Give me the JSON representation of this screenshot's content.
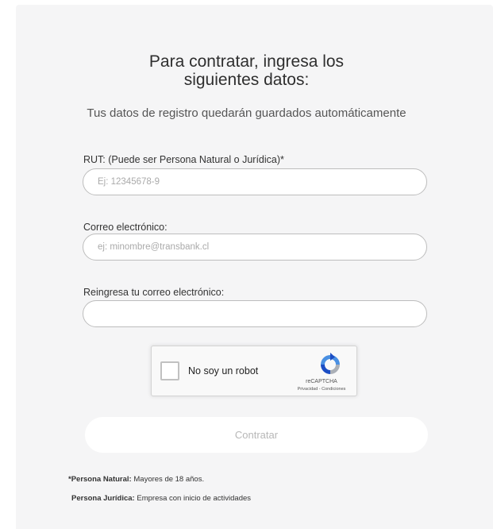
{
  "form": {
    "title_line1": "Para contratar, ingresa los",
    "title_line2": "siguientes datos:",
    "subtitle": "Tus datos de registro quedarán guardados automáticamente",
    "fields": [
      {
        "label": "RUT: (Puede ser Persona Natural o Jurídica)*",
        "value": "",
        "placeholder": "Ej: 12345678-9"
      },
      {
        "label": "Correo electrónico:",
        "value": "",
        "placeholder": "ej: minombre@transbank.cl"
      },
      {
        "label": "Reingresa tu correo electrónico:",
        "value": "",
        "placeholder": ""
      }
    ],
    "submit_label": "Contratar"
  },
  "recaptcha": {
    "label": "No soy un robot",
    "brand": "reCAPTCHA",
    "links": "Privacidad - Condiciones",
    "checked": false,
    "icon": "recaptcha-logo-icon"
  },
  "notes": {
    "natural_term": "*Persona Natural:",
    "natural_text": " Mayores de 18 años.",
    "juridica_term": "Persona Jurídica:",
    "juridica_text": " Empresa con inicio de actividades"
  },
  "colors": {
    "card_background": "#f5f5f6",
    "input_border": "#bdbdbd",
    "disabled_button_text": "#b7b7b7",
    "recaptcha_blue": "#4a90e2"
  }
}
